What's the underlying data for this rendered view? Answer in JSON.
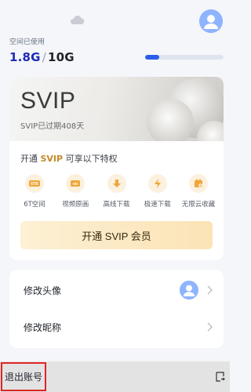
{
  "storage": {
    "label": "空间已使用",
    "used": "1.8G",
    "separator": "/",
    "total": "10G",
    "progress_fraction": 0.18,
    "accent_color": "#2b5ee8"
  },
  "icons": {
    "cloud": "cloud-icon",
    "avatar": "user-avatar-icon",
    "chevron": "chevron-right-icon",
    "switch": "switch-account-icon"
  },
  "svip": {
    "title": "SVIP",
    "expired_text": "SVIP已过期408天",
    "privileges_prefix": "开通 ",
    "privileges_highlight": "SVIP",
    "privileges_suffix": " 可享以下特权",
    "privileges": [
      {
        "label": "6T空间",
        "icon": "6tb-storage-icon",
        "badge": "6TB"
      },
      {
        "label": "视频原画",
        "icon": "hd-video-icon",
        "badge": "HD"
      },
      {
        "label": "高线下载",
        "icon": "download-icon",
        "badge": ""
      },
      {
        "label": "极速下载",
        "icon": "lightning-icon",
        "badge": ""
      },
      {
        "label": "无限云收藏",
        "icon": "cloud-collect-icon",
        "badge": ""
      }
    ],
    "button_label": "开通 SVIP 会员",
    "accent_color": "#c48a2c"
  },
  "settings": {
    "change_avatar_label": "修改头像",
    "change_nickname_label": "修改昵称"
  },
  "bottom": {
    "logout_label": "退出账号",
    "highlight_color": "#e02424"
  }
}
